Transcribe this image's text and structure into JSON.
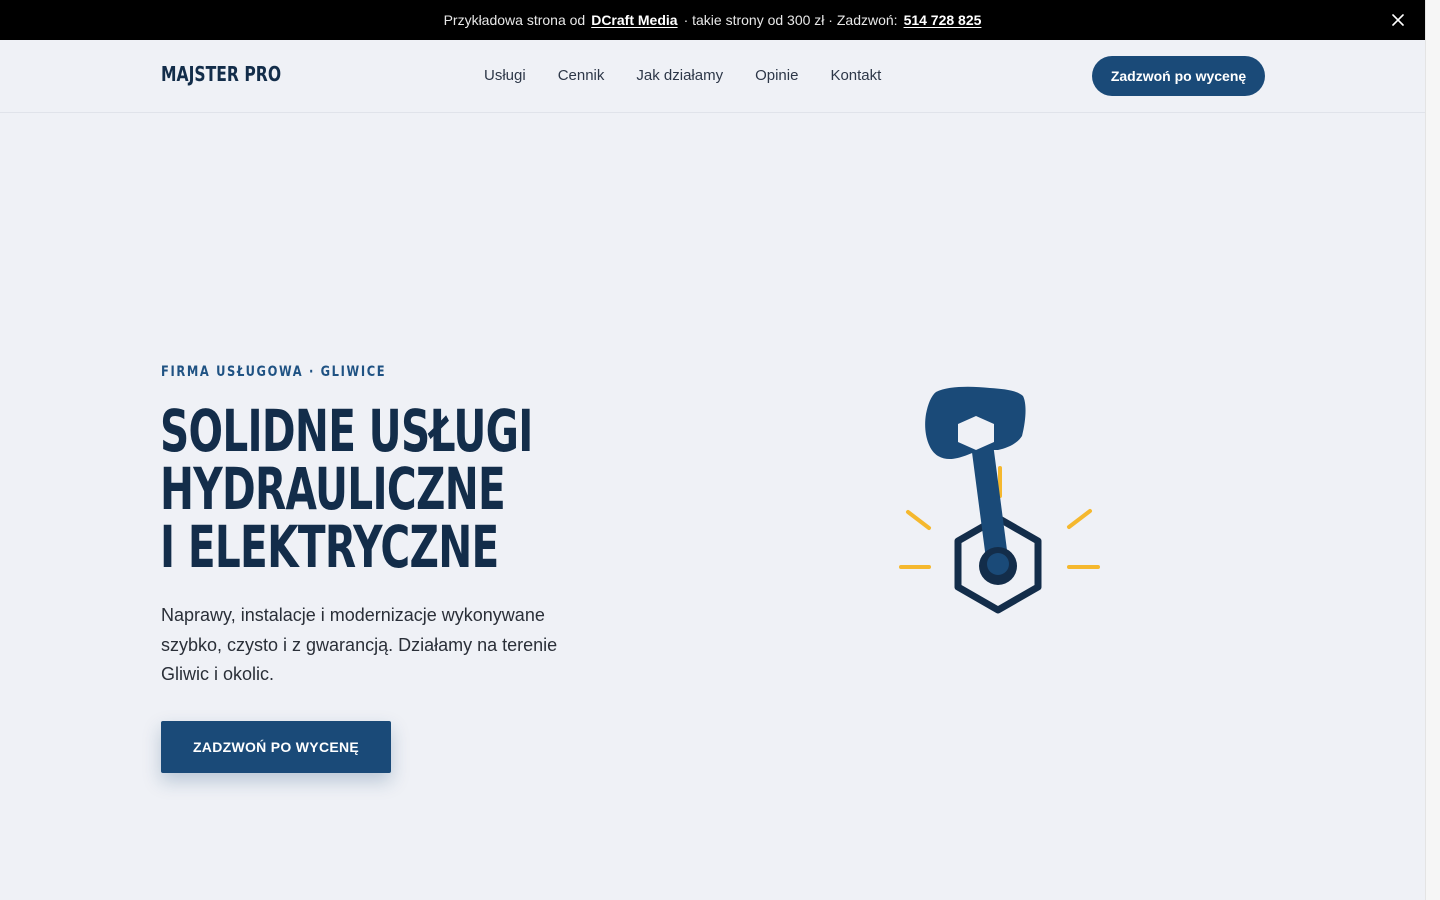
{
  "topbar": {
    "prefix": "Przykładowa strona od",
    "brand_link": "DCraft Media",
    "middle": "· takie strony od 300 zł · Zadzwoń:",
    "phone_link": "514 728 825",
    "close_icon": "close-icon"
  },
  "header": {
    "logo": "MAJSTER PRO",
    "nav": [
      "Usługi",
      "Cennik",
      "Jak działamy",
      "Opinie",
      "Kontakt"
    ],
    "cta": "Zadzwoń po wycenę"
  },
  "hero": {
    "eyebrow": "FIRMA USŁUGOWA · GLIWICE",
    "headline": [
      "SOLIDNE USŁUGI",
      "HYDRAULICZNE",
      "I ELEKTRYCZNE"
    ],
    "lead": "Naprawy, instalacje i modernizacje wykonywane szybko, czysto i z gwarancją. Działamy na terenie Gliwic i okolic.",
    "button": "ZADZWOŃ PO WYCENĘ",
    "illustration_icon": "wrench-nut-icon"
  },
  "colors": {
    "primary": "#1a4a78",
    "dark": "#132d4a",
    "accent": "#f5b82e",
    "background": "#eff1f6"
  }
}
